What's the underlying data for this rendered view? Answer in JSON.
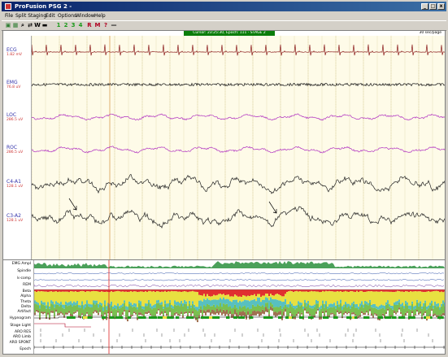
{
  "window": {
    "title": "ProFusion PSG 2 -",
    "minimize_glyph": "_",
    "maximize_glyph": "□",
    "close_glyph": "x"
  },
  "menu": [
    "File",
    "Split Staging",
    "Edit",
    "Options",
    "Window",
    "Help"
  ],
  "toolbar": {
    "buttons": [
      {
        "name": "open-icon",
        "glyph": "▣",
        "color": "#2e7d32"
      },
      {
        "name": "montage-icon",
        "glyph": "▦",
        "color": "#2e7d32"
      },
      {
        "name": "search-icon",
        "glyph": "⌕",
        "color": "#000"
      },
      {
        "name": "arrows-icon",
        "glyph": "⇄",
        "color": "#000"
      },
      {
        "name": "stage-w-button",
        "glyph": "W",
        "color": "#000"
      },
      {
        "name": "video-icon",
        "glyph": "▬",
        "color": "#000"
      },
      {
        "name": "stage-1-button",
        "glyph": "1",
        "color": "#1a9a1a"
      },
      {
        "name": "stage-2-button",
        "glyph": "2",
        "color": "#1a9a1a"
      },
      {
        "name": "stage-3-button",
        "glyph": "3",
        "color": "#1a9a1a"
      },
      {
        "name": "stage-4-button",
        "glyph": "4",
        "color": "#1a9a1a"
      },
      {
        "name": "stage-r-button",
        "glyph": "R",
        "color": "#b00020"
      },
      {
        "name": "stage-m-button",
        "glyph": "M",
        "color": "#b00020"
      },
      {
        "name": "stage-unknown-button",
        "glyph": "?",
        "color": "#b00020"
      },
      {
        "name": "dash-icon",
        "glyph": "—",
        "color": "#000"
      }
    ]
  },
  "epoch_bar": "Cursor: 23:25:30,  Epoch: 111 - STAGE 2",
  "page_info": "30 sec/page",
  "channels": [
    {
      "label": "ECG",
      "scale": "1.82 mV",
      "color": "#8a1a1a"
    },
    {
      "label": "EMG",
      "scale": "76.8 uV",
      "color": "#111111"
    },
    {
      "label": "LOC",
      "scale": "286.5 uV",
      "color": "#b030c0"
    },
    {
      "label": "ROC",
      "scale": "286.5 uV",
      "color": "#b030c0"
    },
    {
      "label": "C4-A1",
      "scale": "128.1 uV",
      "color": "#222222"
    },
    {
      "label": "C3-A2",
      "scale": "128.1 uV",
      "color": "#222222"
    }
  ],
  "hypnogram_labels": [
    "EMG Ampl",
    "Spindle",
    "k-comp",
    "REM",
    "Beta",
    "Alpha",
    "Theta",
    "Delta",
    "Artifact",
    "Hypnogram",
    "Stage Light",
    "ARO RES",
    "ARO Limb",
    "ARO SPONT",
    "Epoch"
  ],
  "colors": {
    "grid_bg": "#fefbe8",
    "cursor_line": "#e0b070",
    "red_marker": "#e02020",
    "epoch_green": "#0a7d0a"
  }
}
